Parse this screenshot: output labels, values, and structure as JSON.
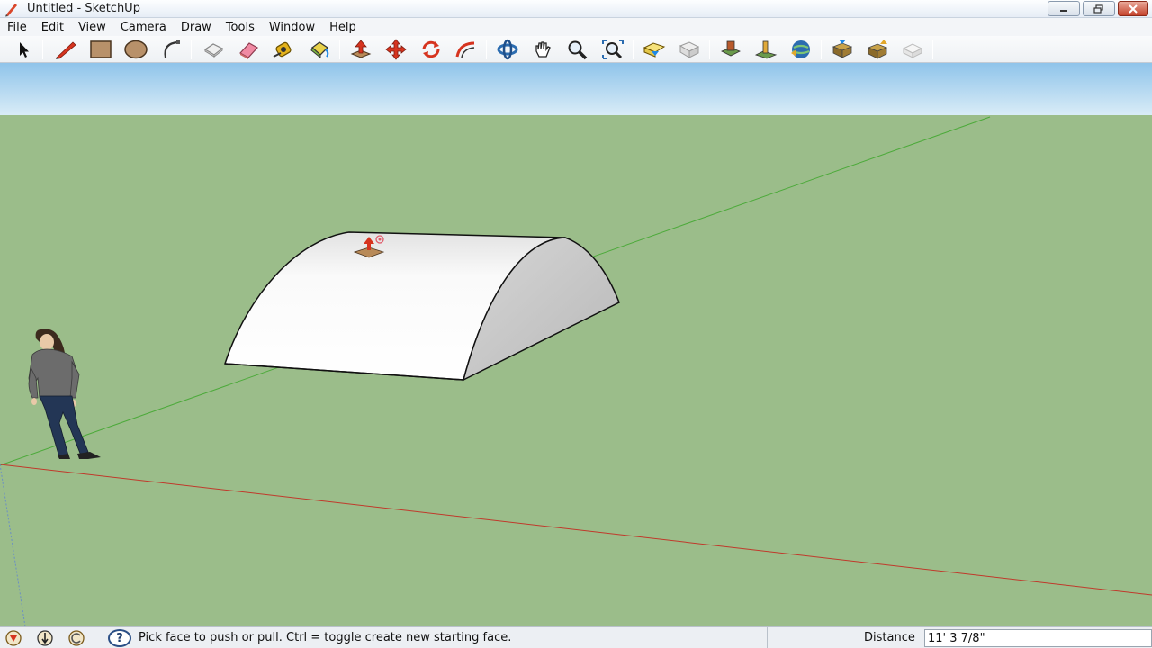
{
  "window": {
    "title": "Untitled - SketchUp"
  },
  "menu": {
    "items": [
      "File",
      "Edit",
      "View",
      "Camera",
      "Draw",
      "Tools",
      "Window",
      "Help"
    ]
  },
  "toolbar": {
    "tools": [
      {
        "name": "select-icon",
        "label": "Select"
      },
      {
        "name": "line-icon",
        "label": "Line"
      },
      {
        "name": "rectangle-icon",
        "label": "Rectangle"
      },
      {
        "name": "circle-icon",
        "label": "Circle"
      },
      {
        "name": "arc-icon",
        "label": "Arc"
      },
      {
        "name": "make-component-icon",
        "label": "Make Component"
      },
      {
        "name": "eraser-icon",
        "label": "Eraser"
      },
      {
        "name": "tape-measure-icon",
        "label": "Tape Measure"
      },
      {
        "name": "paint-bucket-icon",
        "label": "Paint Bucket"
      },
      {
        "name": "push-pull-icon",
        "label": "Push/Pull"
      },
      {
        "name": "move-icon",
        "label": "Move"
      },
      {
        "name": "rotate-icon",
        "label": "Rotate"
      },
      {
        "name": "offset-icon",
        "label": "Offset"
      },
      {
        "name": "orbit-icon",
        "label": "Orbit"
      },
      {
        "name": "pan-icon",
        "label": "Pan"
      },
      {
        "name": "zoom-icon",
        "label": "Zoom"
      },
      {
        "name": "zoom-extents-icon",
        "label": "Zoom Extents"
      },
      {
        "name": "get-models-icon",
        "label": "Get Models"
      },
      {
        "name": "share-model-icon",
        "label": "Share Model"
      },
      {
        "name": "get-current-view-icon",
        "label": "Get Current View"
      },
      {
        "name": "toggle-terrain-icon",
        "label": "Toggle Terrain"
      },
      {
        "name": "add-location-icon",
        "label": "Add Location"
      },
      {
        "name": "preview-google-earth-icon",
        "label": "Preview Model in Google Earth"
      },
      {
        "name": "get-models-3d-icon",
        "label": "Get Models"
      },
      {
        "name": "share-component-icon",
        "label": "Share Component"
      },
      {
        "name": "extension-icon",
        "label": "Extension"
      }
    ]
  },
  "colors": {
    "sky": "#a9d2f0",
    "ground": "#9bbd8a",
    "axis_red": "#c0392b",
    "axis_green": "#4caa3a",
    "axis_blue": "#6b8fc4"
  },
  "status": {
    "message": "Pick face to push or pull.  Ctrl = toggle create new starting face.",
    "vcb_label": "Distance",
    "vcb_value": "11' 3 7/8\""
  }
}
